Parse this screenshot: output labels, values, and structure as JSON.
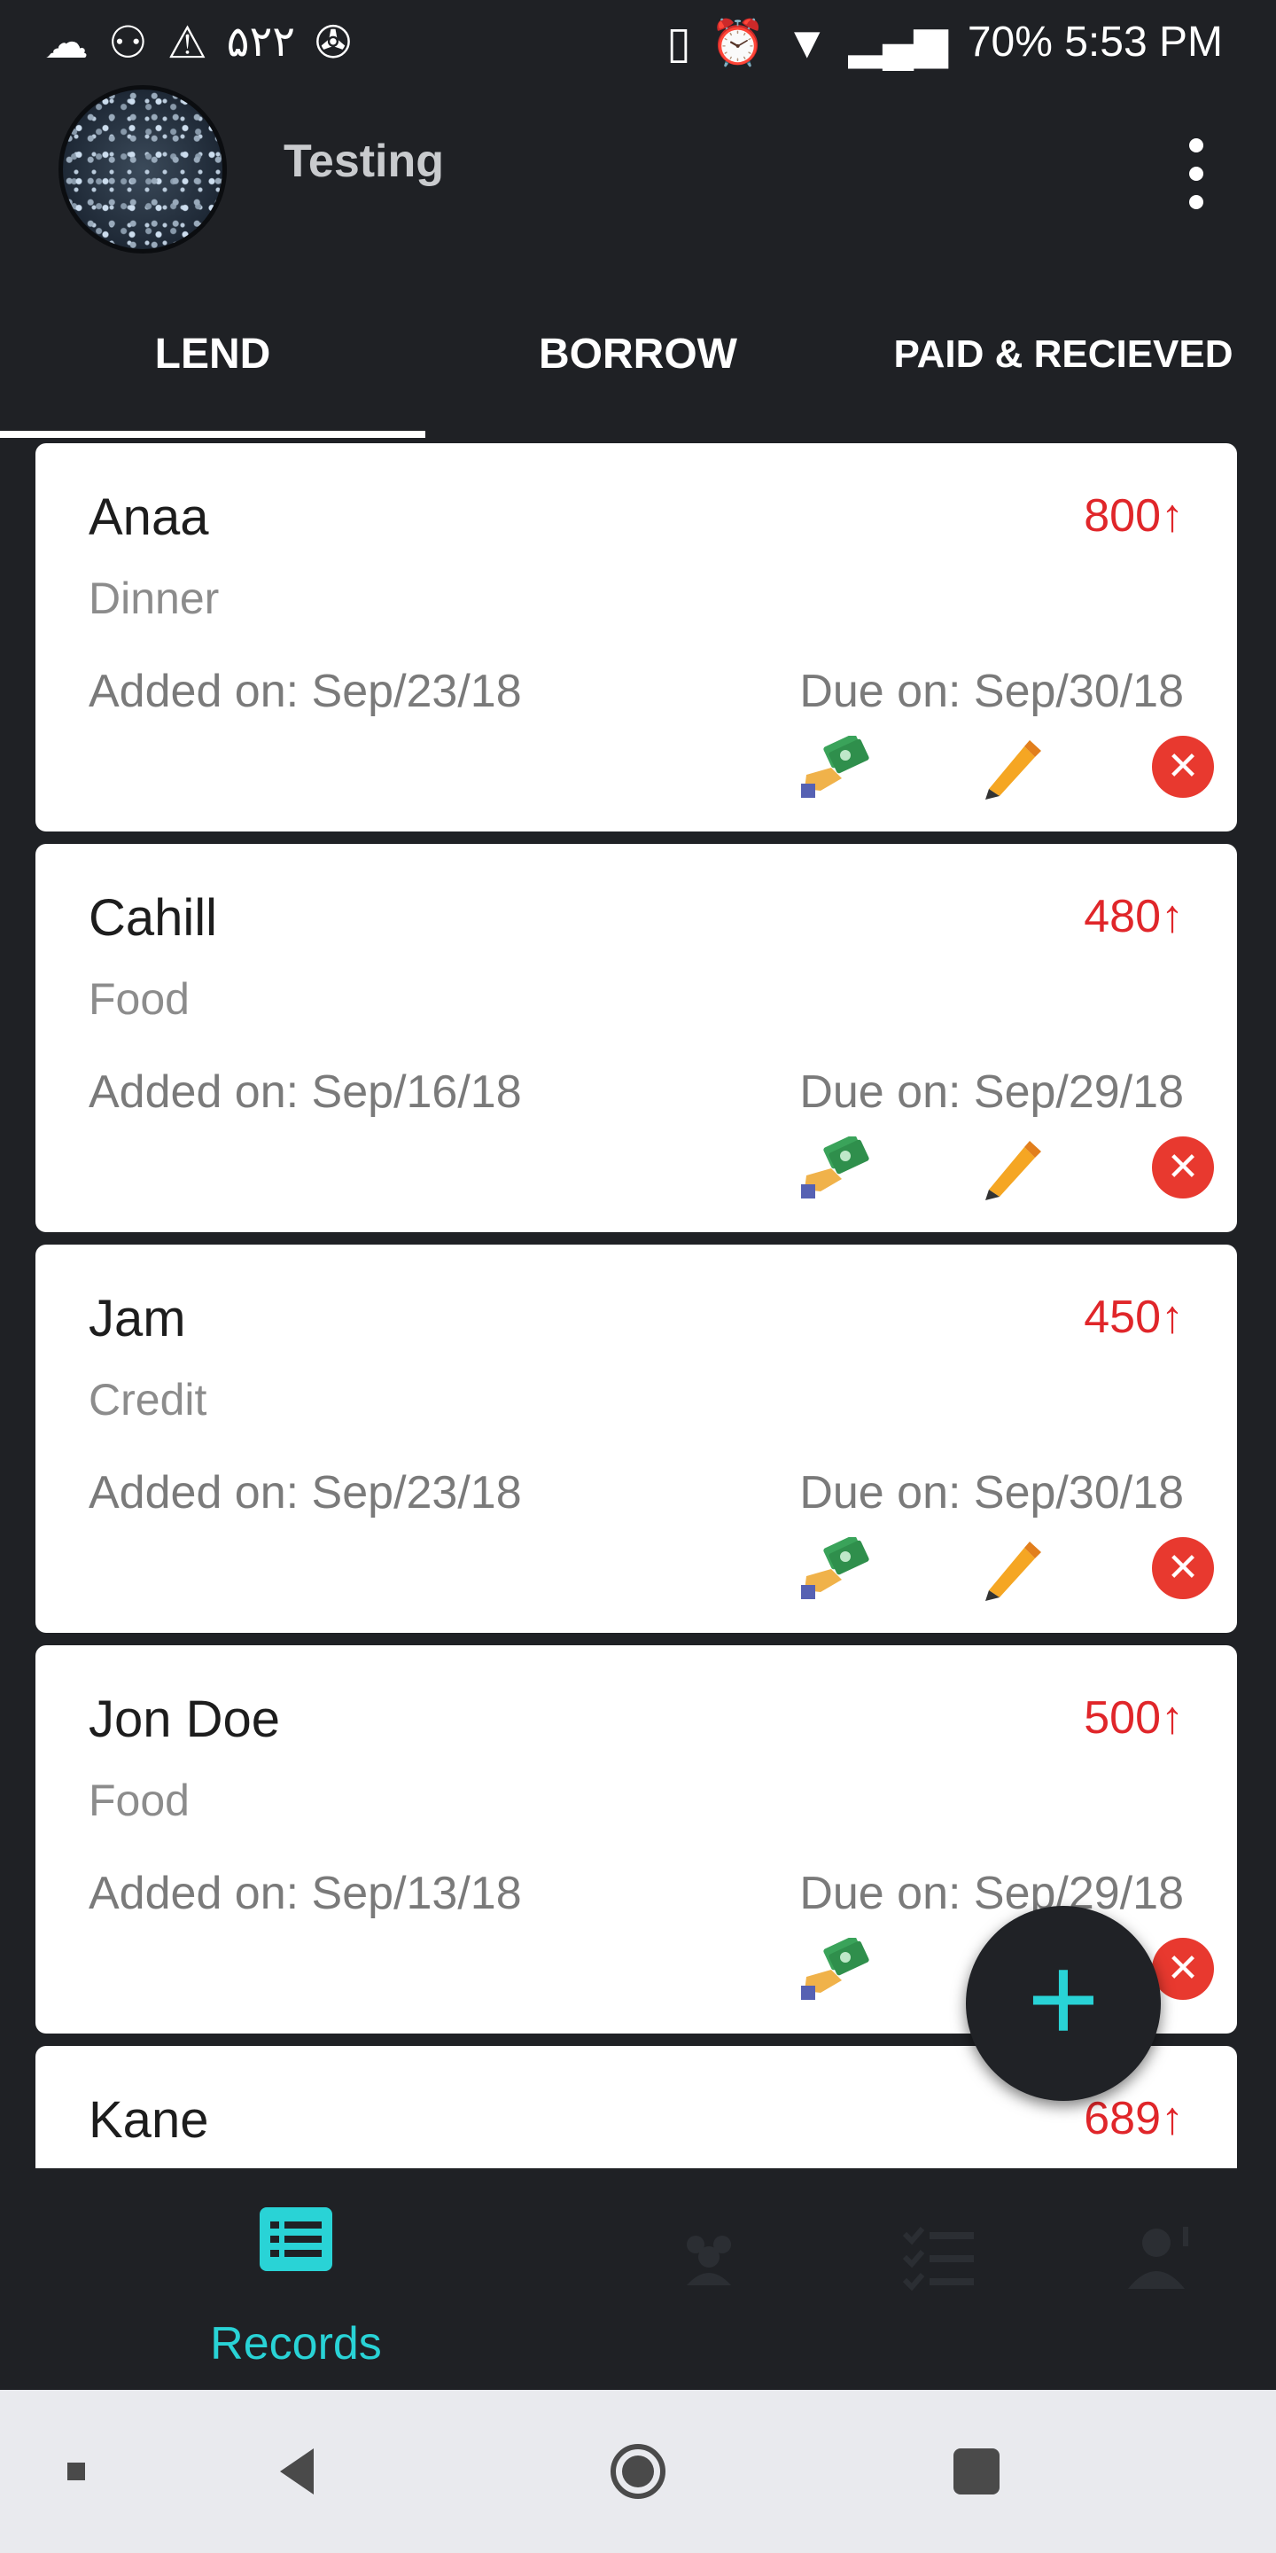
{
  "status_bar": {
    "left_text": "۵۲۲",
    "right_text": "70% 5:53 PM"
  },
  "toolbar": {
    "title": "Testing"
  },
  "tabs": [
    {
      "label": "LEND"
    },
    {
      "label": "BORROW"
    },
    {
      "label": "PAID & RECIEVED"
    }
  ],
  "records": [
    {
      "name": "Anaa",
      "amount": "800↑",
      "category": "Dinner",
      "added": "Added on: Sep/23/18",
      "due": "Due on:  Sep/30/18"
    },
    {
      "name": "Cahill",
      "amount": "480↑",
      "category": "Food",
      "added": "Added on: Sep/16/18",
      "due": "Due on:  Sep/29/18"
    },
    {
      "name": "Jam",
      "amount": "450↑",
      "category": "Credit",
      "added": "Added on: Sep/23/18",
      "due": "Due on:  Sep/30/18"
    },
    {
      "name": "Jon Doe",
      "amount": "500↑",
      "category": "Food",
      "added": "Added on: Sep/13/18",
      "due": "Due on:  Sep/29/18"
    },
    {
      "name": "Kane",
      "amount": "689↑",
      "category": "",
      "added": "",
      "due": ""
    }
  ],
  "bottom_nav": {
    "active_label": "Records",
    "items": [
      "records-icon",
      "group-icon",
      "checklist-icon",
      "profile-icon"
    ]
  },
  "colors": {
    "accent": "#29d3d6",
    "amount": "#e0262a",
    "background": "#1f2125"
  }
}
